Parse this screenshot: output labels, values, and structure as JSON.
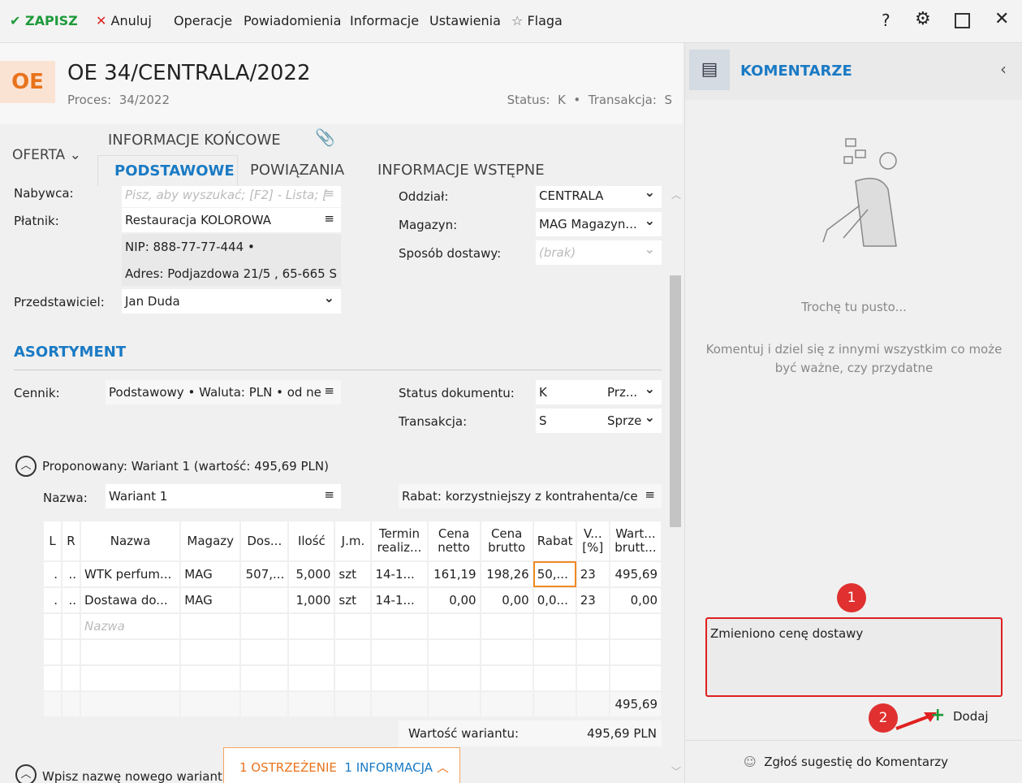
{
  "toolbar": {
    "save": "ZAPISZ",
    "cancel": "Anuluj",
    "operations": "Operacje",
    "notifications": "Powiadomienia",
    "information": "Informacje",
    "settings": "Ustawienia",
    "flag": "Flaga"
  },
  "header": {
    "badge": "OE",
    "title": "OE 34/CENTRALA/2022",
    "process_label": "Proces:",
    "process": "34/2022",
    "status_label": "Status:",
    "status": "K",
    "transaction_label": "Transakcja:",
    "transaction": "S"
  },
  "tabs": {
    "oferta": "OFERTA",
    "final": "INFORMACJE KOŃCOWE",
    "basic": "PODSTAWOWE",
    "links": "POWIĄZANIA",
    "initial": "INFORMACJE WSTĘPNE"
  },
  "form": {
    "buyer_label": "Nabywca:",
    "buyer_placeholder": "Pisz, aby wyszukać; [F2] - Lista; [",
    "payer_label": "Płatnik:",
    "payer": "Restauracja KOLOROWA",
    "nip": "NIP:  888-77-77-444  •",
    "address": "Adres:  Podjazdowa  21/5 , 65-665 S",
    "rep_label": "Przedstawiciel:",
    "rep": "Jan Duda",
    "branch_label": "Oddział:",
    "branch": "CENTRALA",
    "warehouse_label": "Magazyn:",
    "warehouse": "MAG  Magazyn...",
    "delivery_label": "Sposób dostawy:",
    "delivery": "(brak)"
  },
  "assortment": {
    "title": "ASORTYMENT",
    "pricelist_label": "Cennik:",
    "pricelist": "Podstawowy • Waluta: PLN • od ne",
    "docstatus_label": "Status dokumentu:",
    "docstatus": "K",
    "docstatus_desc": "Prz...",
    "trans_label": "Transakcja:",
    "trans": "S",
    "trans_desc": "Sprze"
  },
  "variant": {
    "title": "Proponowany: Wariant 1 (wartość: 495,69 PLN)",
    "name_label": "Nazwa:",
    "name": "Wariant 1",
    "discount": "Rabat: korzystniejszy z kontrahenta/ce",
    "total": "495,69",
    "value_label": "Wartość wariantu:",
    "value": "495,69 PLN",
    "new_variant": "Wpisz nazwę nowego wariantu"
  },
  "table": {
    "headers": [
      "L",
      "R",
      "Nazwa",
      "Magazy",
      "Dos...",
      "Ilość",
      "J.m.",
      "Termin realiz...",
      "Cena netto",
      "Cena brutto",
      "Rabat",
      "V... [%]",
      "Wart... brutt..."
    ],
    "rows": [
      [
        ".",
        "..",
        "WTK perfum...",
        "MAG",
        "507,...",
        "5,000",
        "szt",
        "14-1...",
        "161,19",
        "198,26",
        "50,...",
        "23",
        "495,69"
      ],
      [
        ".",
        "..",
        "Dostawa do...",
        "MAG",
        "",
        "1,000",
        "szt",
        "14-1...",
        "0,00",
        "0,00",
        "0,0...",
        "23",
        "0,00"
      ]
    ],
    "placeholder": "Nazwa"
  },
  "alerts": {
    "warning": "1 OSTRZEŻENIE",
    "info": "1 INFORMACJA"
  },
  "comments": {
    "title": "KOMENTARZE",
    "empty_title": "Trochę tu pusto...",
    "empty_text": "Komentuj i dziel się z innymi wszystkim co może być ważne, czy przydatne",
    "input": "Zmieniono cenę dostawy",
    "add": "Dodaj",
    "suggest": "Zgłoś sugestię do Komentarzy",
    "marker1": "1",
    "marker2": "2"
  }
}
